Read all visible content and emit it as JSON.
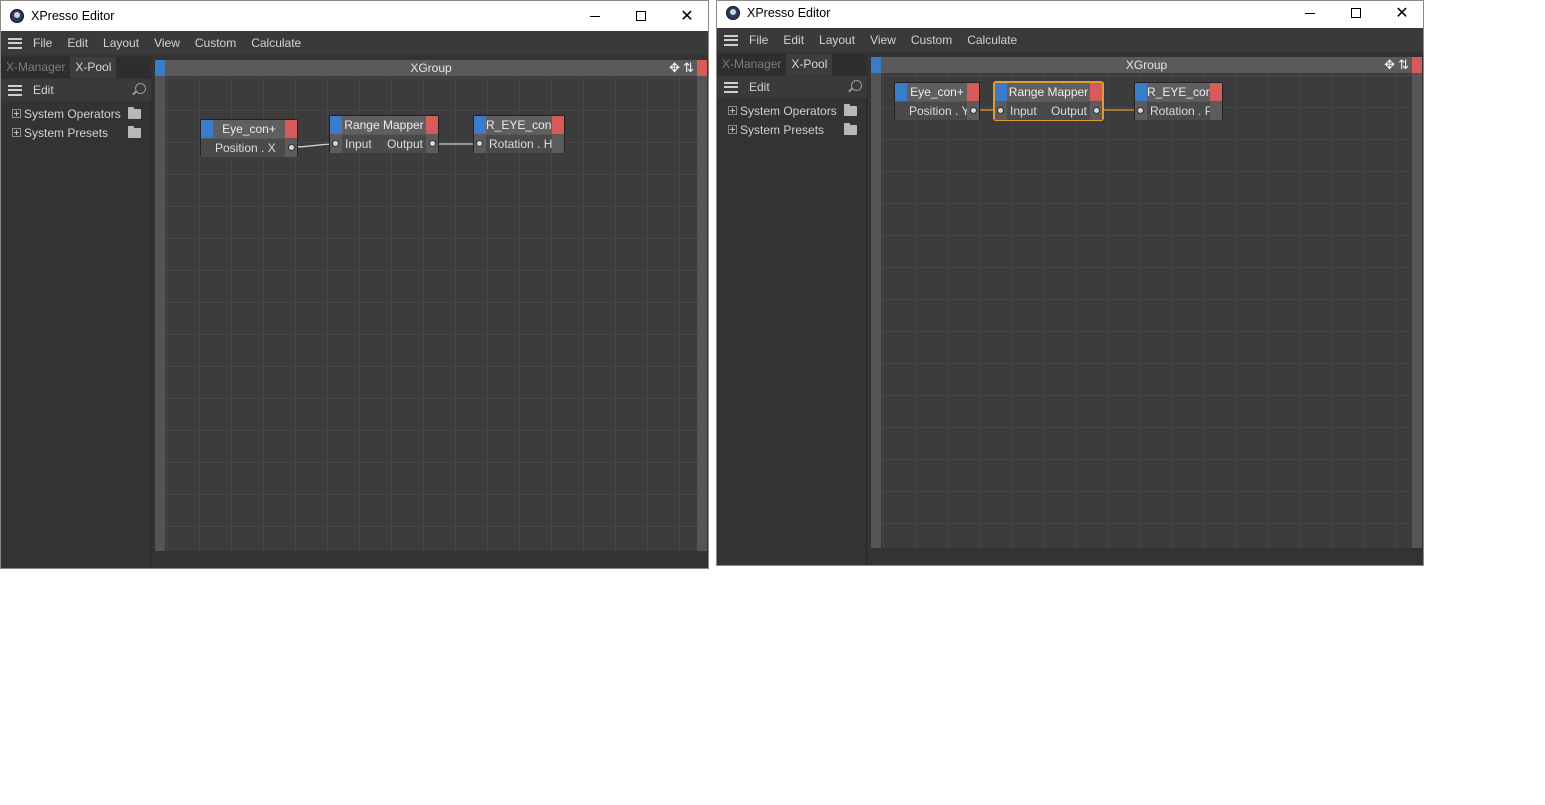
{
  "windows": [
    {
      "title": "XPresso Editor",
      "menu": [
        "File",
        "Edit",
        "Layout",
        "View",
        "Custom",
        "Calculate"
      ],
      "tabs": [
        "X-Manager",
        "X-Pool"
      ],
      "active_tab": "X-Pool",
      "side_edit": "Edit",
      "tree": [
        "System Operators",
        "System Presets"
      ],
      "group_title": "XGroup",
      "nodes": {
        "eye": {
          "title": "Eye_con+",
          "port": "Position . X"
        },
        "mapper": {
          "title": "Range Mapper",
          "input": "Input",
          "output": "Output"
        },
        "reye": {
          "title": "R_EYE_con+",
          "port": "Rotation . H"
        }
      }
    },
    {
      "title": "XPresso Editor",
      "menu": [
        "File",
        "Edit",
        "Layout",
        "View",
        "Custom",
        "Calculate"
      ],
      "tabs": [
        "X-Manager",
        "X-Pool"
      ],
      "active_tab": "X-Pool",
      "side_edit": "Edit",
      "tree": [
        "System Operators",
        "System Presets"
      ],
      "group_title": "XGroup",
      "nodes": {
        "eye": {
          "title": "Eye_con+",
          "port": "Position . Y"
        },
        "mapper": {
          "title": "Range Mapper",
          "input": "Input",
          "output": "Output"
        },
        "reye": {
          "title": "R_EYE_con+",
          "port": "Rotation . P"
        }
      }
    }
  ],
  "colors": {
    "accent_blue": "#3b7cc9",
    "accent_red": "#d65c5c",
    "selection_orange": "#e39b3a",
    "wire_white": "#d0d0d0",
    "wire_orange": "#e39b3a"
  },
  "icons": [
    "app-icon",
    "hamburger-icon",
    "search-icon",
    "folder-icon",
    "plus-box-icon",
    "move-icon",
    "arrow-icon",
    "minimize-icon",
    "maximize-icon",
    "close-icon"
  ]
}
